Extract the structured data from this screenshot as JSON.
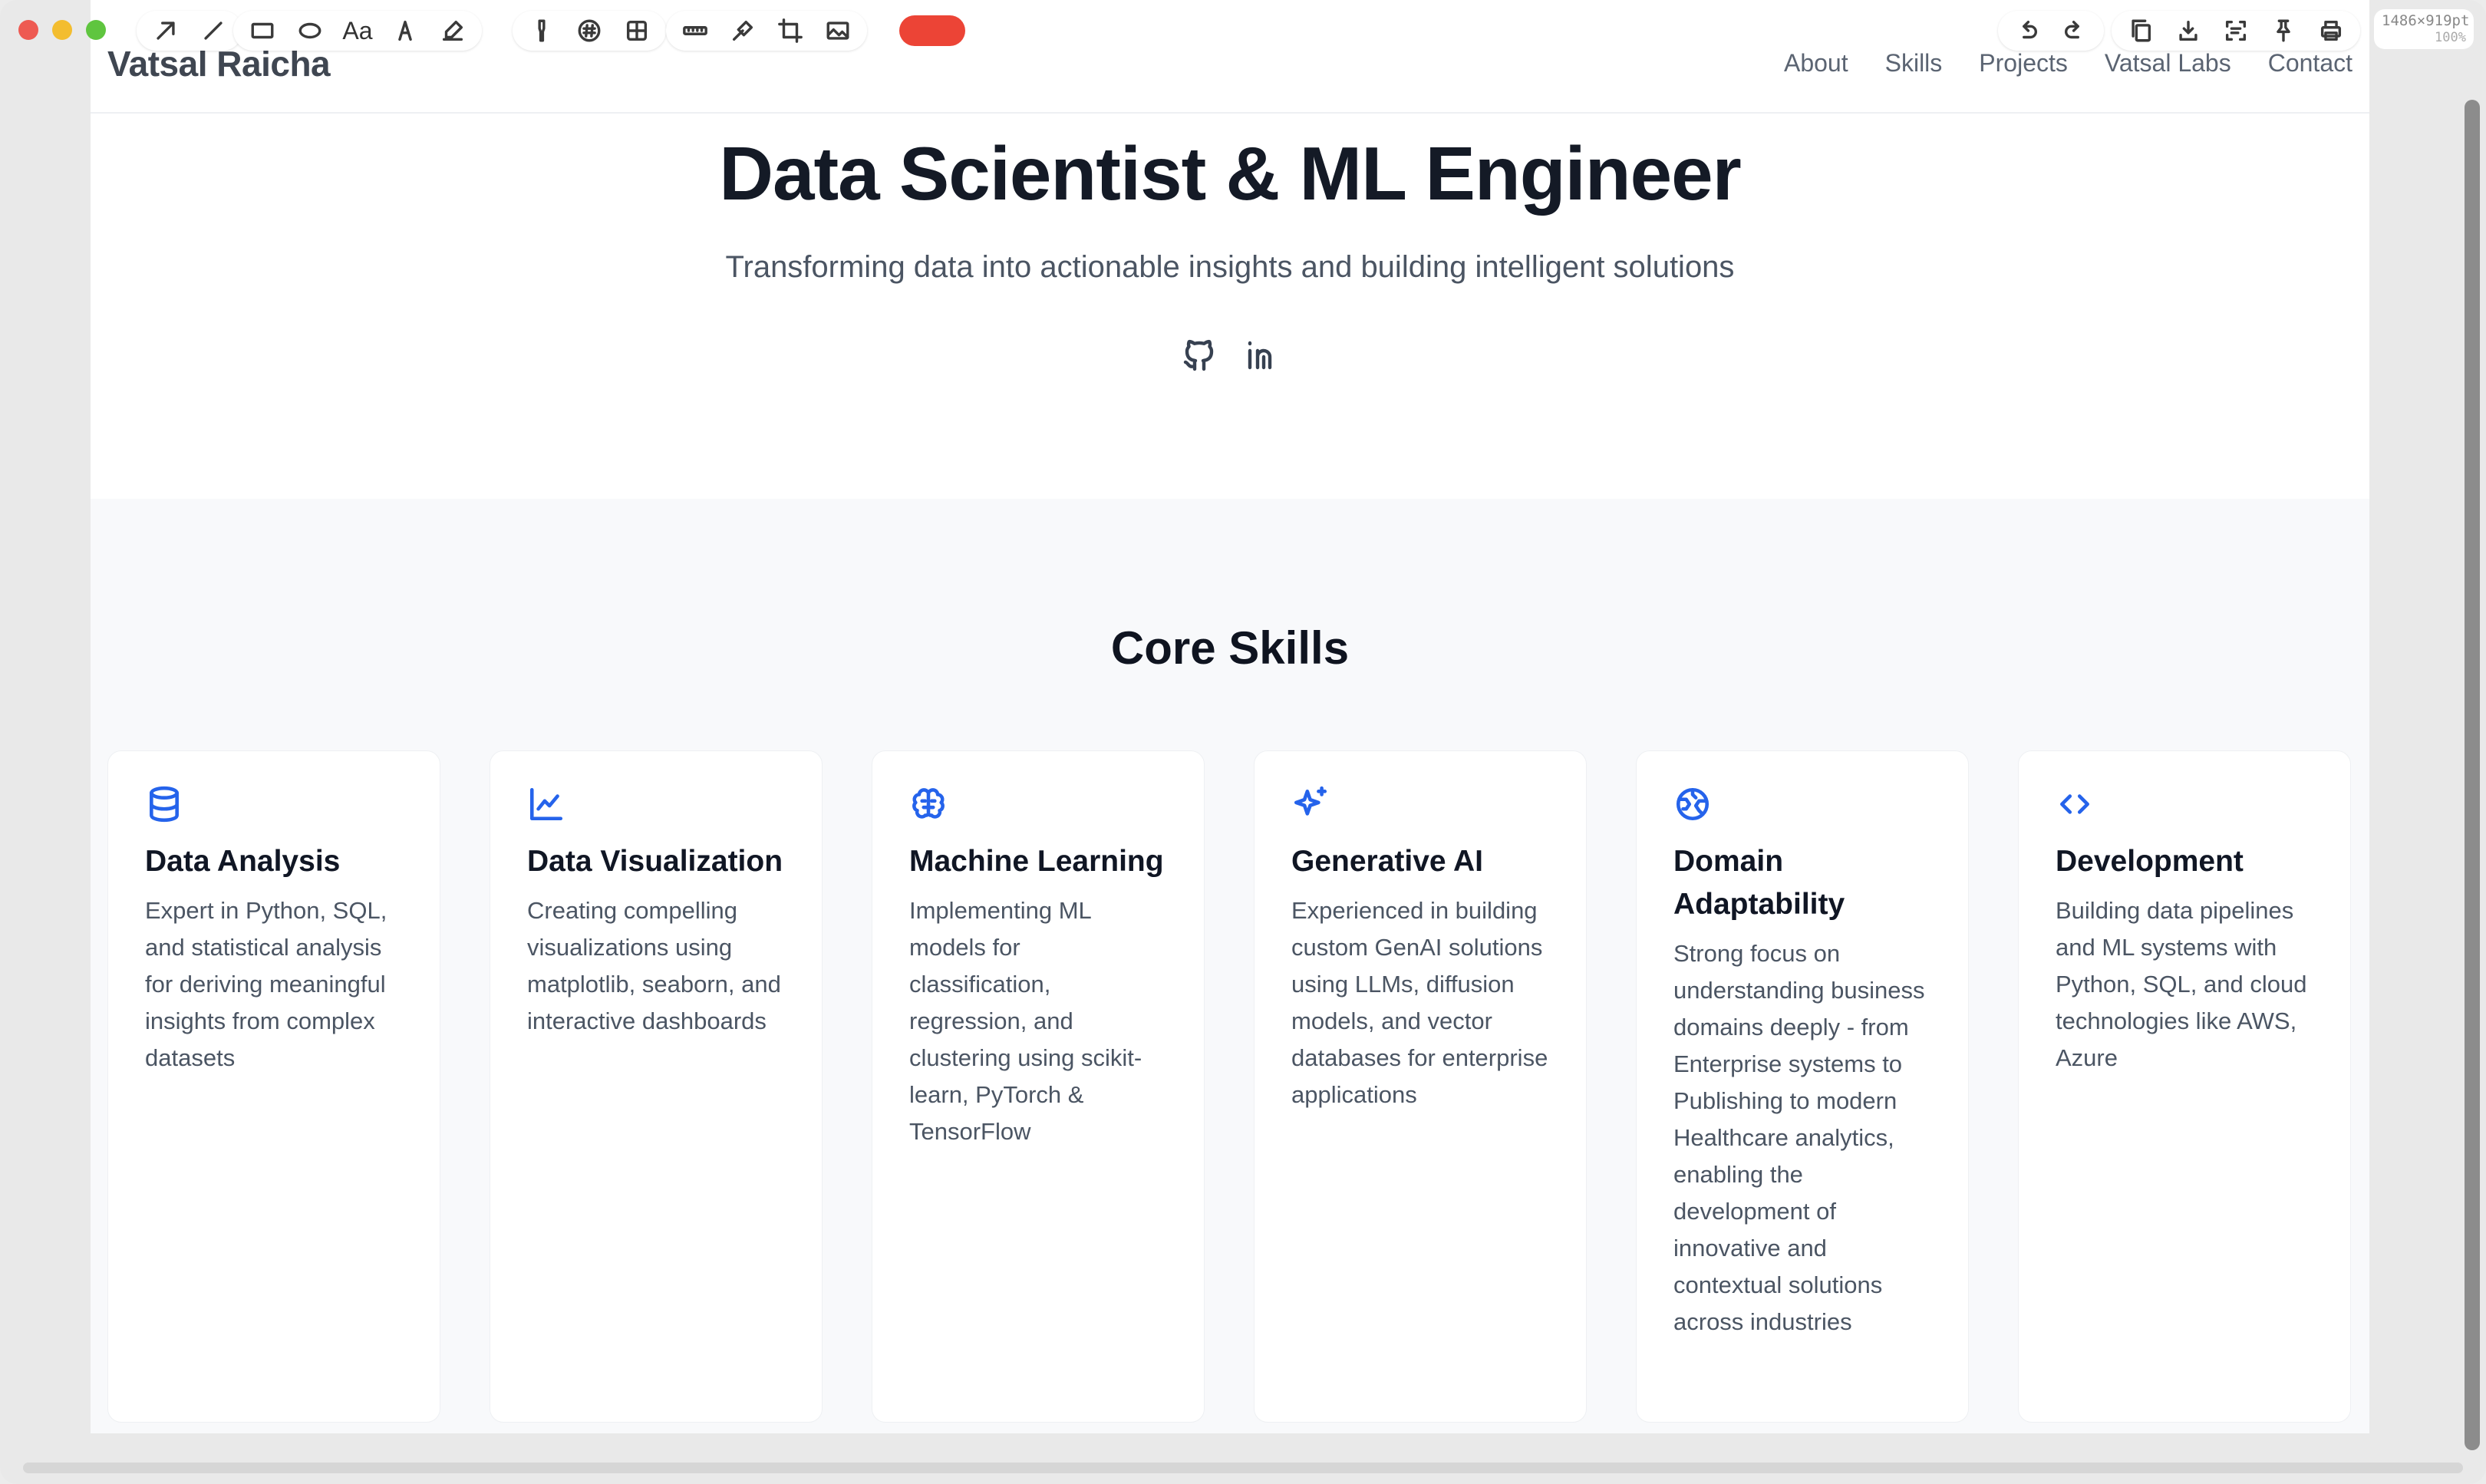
{
  "toolbar": {
    "text_tool_label": "Aa",
    "size_readout": "1486×919pt",
    "zoom_readout": "100%",
    "record_color": "#ec4436"
  },
  "site": {
    "brand": "Vatsal Raicha",
    "nav": [
      "About",
      "Skills",
      "Projects",
      "Vatsal Labs",
      "Contact"
    ]
  },
  "hero": {
    "title": "Data Scientist & ML Engineer",
    "subtitle": "Transforming data into actionable insights and building intelligent solutions",
    "social": [
      "github-icon",
      "linkedin-icon"
    ]
  },
  "skills": {
    "title": "Core Skills",
    "accent_color": "#2563eb",
    "items": [
      {
        "icon": "database-icon",
        "title": "Data Analysis",
        "text": "Expert in Python, SQL, and statistical analysis for deriving meaningful insights from complex datasets"
      },
      {
        "icon": "line-chart-icon",
        "title": "Data Visualization",
        "text": "Creating compelling visualizations using matplotlib, seaborn, and interactive dashboards"
      },
      {
        "icon": "brain-icon",
        "title": "Machine Learning",
        "text": "Implementing ML models for classification, regression, and clustering using scikit-learn, PyTorch & TensorFlow"
      },
      {
        "icon": "sparkles-icon",
        "title": "Generative AI",
        "text": "Experienced in building custom GenAI solutions using LLMs, diffusion models, and vector databases for enterprise applications"
      },
      {
        "icon": "globe-icon",
        "title": "Domain Adaptability",
        "text": "Strong focus on understanding business domains deeply - from Enterprise systems to Publishing to modern Healthcare analytics, enabling the development of innovative and contextual solutions across industries"
      },
      {
        "icon": "code-icon",
        "title": "Development",
        "text": "Building data pipelines and ML systems with Python, SQL, and cloud technologies like AWS, Azure"
      }
    ]
  }
}
